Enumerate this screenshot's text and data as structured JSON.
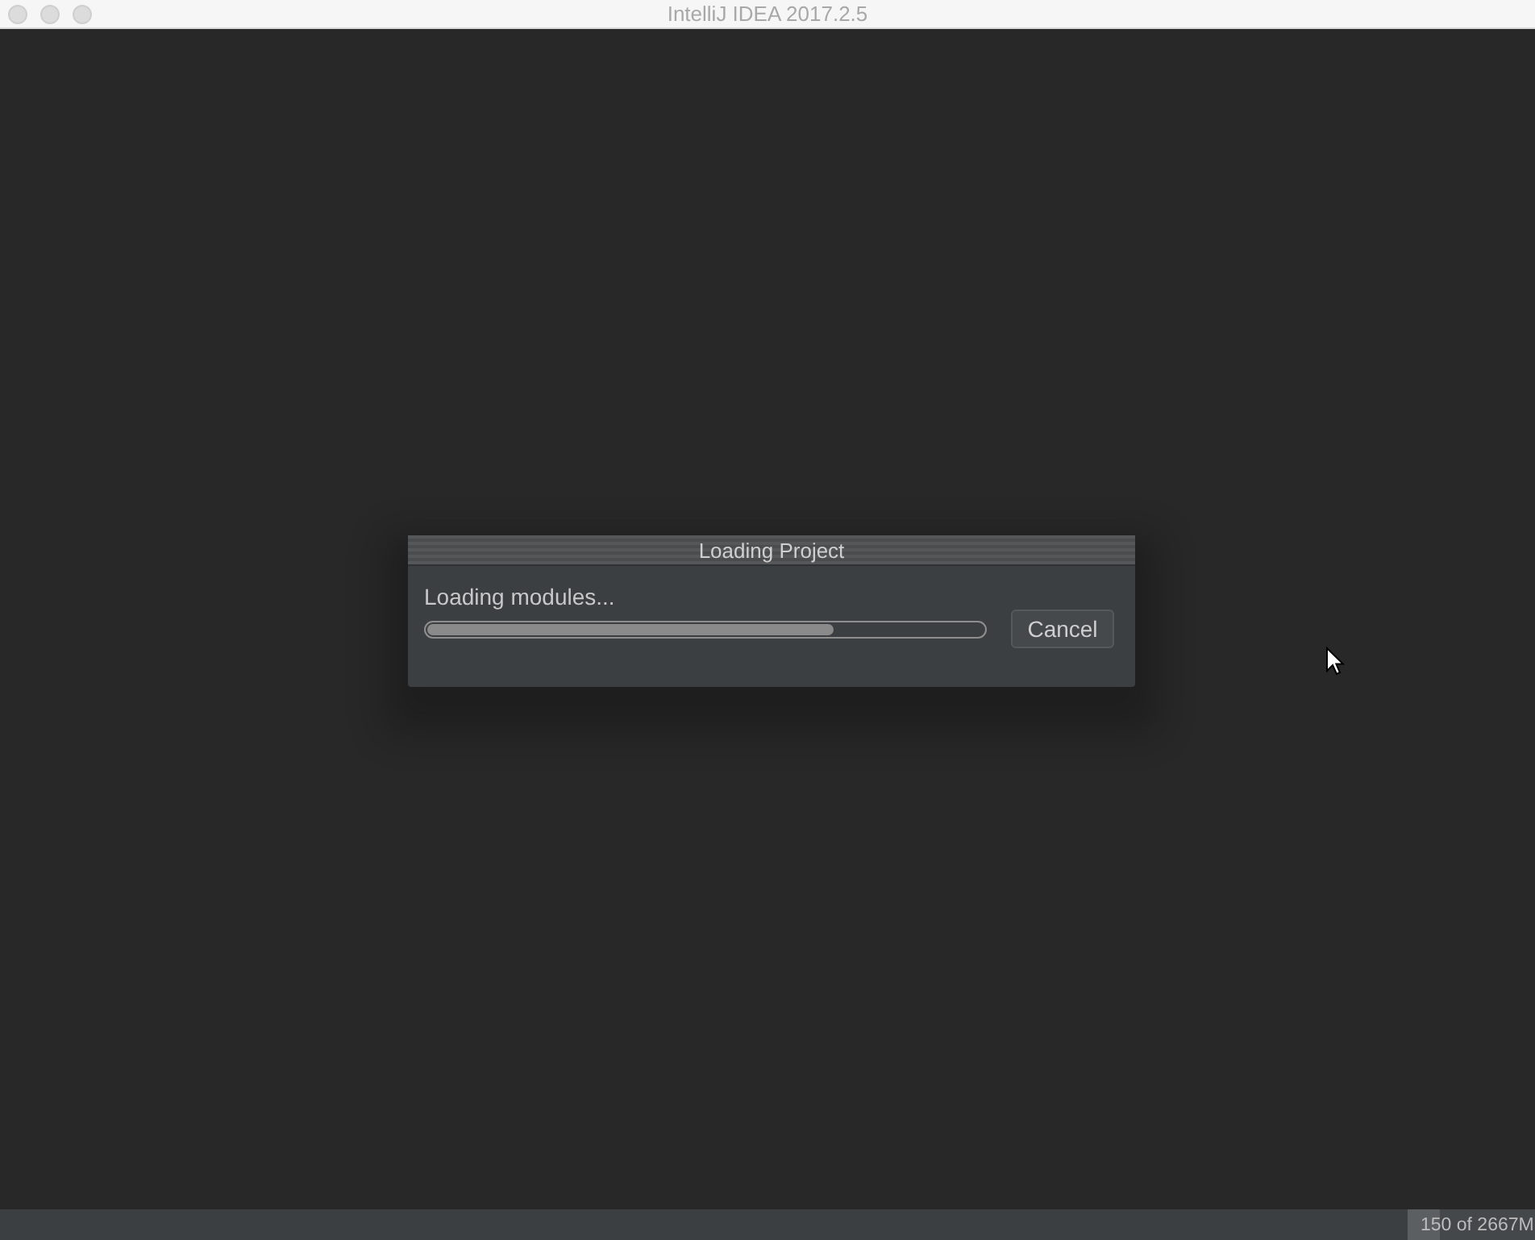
{
  "window": {
    "title": "IntelliJ IDEA 2017.2.5"
  },
  "dialog": {
    "title": "Loading Project",
    "status": "Loading modules...",
    "progress": {
      "level": 0.73
    },
    "buttons": [
      {
        "label": "Cancel"
      }
    ]
  },
  "status_bar": {
    "memory_indicator": {
      "text": "150 of 2667M",
      "level": 0.25
    }
  }
}
